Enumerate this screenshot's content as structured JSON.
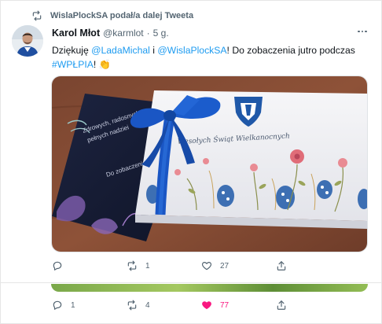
{
  "retweet": {
    "icon": "retweet-icon",
    "text": "WislaPlockSA podał/a dalej Tweeta"
  },
  "tweet": {
    "author_name": "Karol Młot",
    "author_handle": "@karmlot",
    "separator": "·",
    "time": "5 g.",
    "text": {
      "t1": "Dziękuję ",
      "mention1": "@LadaMichal",
      "t2": " i ",
      "mention2": "@WislaPlockSA",
      "t3": "! Do zobaczenia jutro podczas",
      "hashtag": "#WPŁPIA",
      "t4": "! ",
      "emoji": "👏"
    },
    "media": {
      "card_text_1": "Zdrowych, radosnych",
      "card_text_2": "pełnych nadziei",
      "card_text_3": "Do zobaczenia",
      "box_text": "Wesołych Świąt Wielkanocnych"
    },
    "actions": {
      "reply_count": "",
      "retweet_count": "1",
      "like_count": "27"
    }
  },
  "next_tweet": {
    "actions": {
      "reply_count": "1",
      "retweet_count": "4",
      "like_count": "77"
    }
  },
  "colors": {
    "accent": "#1d9bf0",
    "like_active": "#f91880",
    "muted": "#536471"
  }
}
